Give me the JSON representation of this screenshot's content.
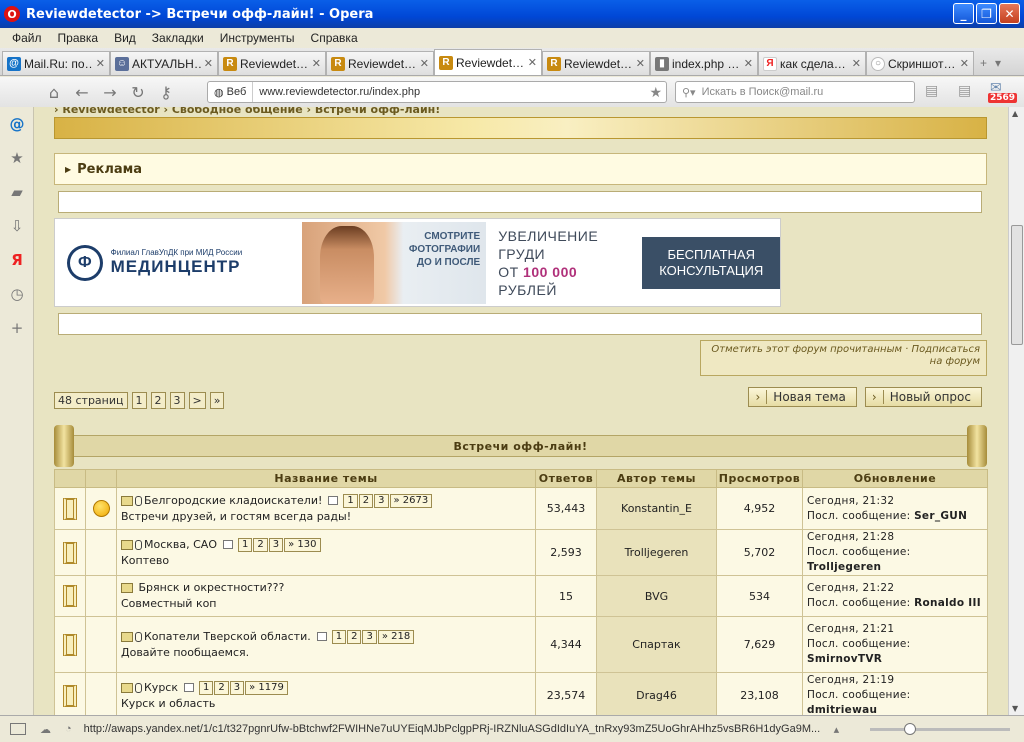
{
  "window": {
    "title": "Reviewdetector -> Встречи офф-лайн! - Opera"
  },
  "menu": [
    "Файл",
    "Правка",
    "Вид",
    "Закладки",
    "Инструменты",
    "Справка"
  ],
  "tabs": [
    {
      "label": "Mail.Ru: по…",
      "icon": "mailru-icon"
    },
    {
      "label": "АКТУАЛЬН…",
      "icon": "user-icon"
    },
    {
      "label": "Reviewdet…",
      "icon": "r-icon"
    },
    {
      "label": "Reviewdet…",
      "icon": "r-icon"
    },
    {
      "label": "Reviewdet…",
      "icon": "r-icon",
      "active": true
    },
    {
      "label": "Reviewdet…",
      "icon": "r-icon"
    },
    {
      "label": "index.php …",
      "icon": "page-icon"
    },
    {
      "label": "как сдела…",
      "icon": "yandex-icon"
    },
    {
      "label": "Скриншот…",
      "icon": "loading-icon"
    }
  ],
  "address": {
    "web_label": "Веб",
    "url": "www.reviewdetector.ru/index.php",
    "search_placeholder": "Искать в Поиск@mail.ru",
    "mail_count": "2569"
  },
  "page": {
    "breadcrumb": "› Reviewdetector › Свободное общение › Встречи офф-лайн!",
    "ad_title": "Реклама",
    "banner": {
      "org_small": "Филиал ГлавУпДК при МИД России",
      "org": "МЕДИНЦЕНТР",
      "photo_text": "СМОТРИТЕ ФОТОГРАФИИ ДО И ПОСЛЕ",
      "line1": "УВЕЛИЧЕНИЕ",
      "line2": "ГРУДИ",
      "line3a": "ОТ ",
      "price": "100 000",
      "line4": "РУБЛЕЙ",
      "cta": "БЕСПЛАТНАЯ КОНСУЛЬТАЦИЯ"
    },
    "mark_read": "Отметить этот форум прочитанным · Подписаться на форум",
    "pages_label": "48 страниц",
    "pages": [
      "1",
      "2",
      "3",
      ">",
      "»"
    ],
    "new_topic": "Новая тема",
    "new_poll": "Новый опрос",
    "forum_title": "Встречи офф-лайн!",
    "columns": [
      "Название темы",
      "Ответов",
      "Автор темы",
      "Просмотров",
      "Обновление"
    ],
    "topics": [
      {
        "title": "Белгородские кладоискатели!",
        "desc": "Встречи друзей, и гостям всегда рады!",
        "pages": [
          "1",
          "2",
          "3",
          "» 2673"
        ],
        "replies": "53,443",
        "author": "Konstantin_E",
        "views": "4,952",
        "time": "Сегодня, 21:32",
        "last_label": "Посл. сообщение:",
        "last": "Ser_GUN",
        "smile": true,
        "clip": true
      },
      {
        "title": "Москва, САО",
        "desc": "Коптево",
        "pages": [
          "1",
          "2",
          "3",
          "» 130"
        ],
        "replies": "2,593",
        "author": "Trolljegeren",
        "views": "5,702",
        "time": "Сегодня, 21:28",
        "last_label": "Посл. сообщение:",
        "last": "Trolljegeren",
        "clip": true
      },
      {
        "title": "Брянск и окрестности???",
        "desc": "Совместный коп",
        "pages": [],
        "replies": "15",
        "author": "BVG",
        "views": "534",
        "time": "Сегодня, 21:22",
        "last_label": "Посл. сообщение:",
        "last": "Ronaldo III"
      },
      {
        "title": "Копатели Тверской области.",
        "desc": "Довайте пообщаемся.",
        "pages": [
          "1",
          "2",
          "3",
          "» 218"
        ],
        "replies": "4,344",
        "author": "Спартак",
        "views": "7,629",
        "time": "Сегодня, 21:21",
        "last_label": "Посл. сообщение:",
        "last": "SmirnovTVR",
        "clip": true
      },
      {
        "title": "Курск",
        "desc": "Курск и область",
        "pages": [
          "1",
          "2",
          "3",
          "» 1179"
        ],
        "replies": "23,574",
        "author": "Drag46",
        "views": "23,108",
        "time": "Сегодня, 21:19",
        "last_label": "Посл. сообщение:",
        "last": "dmitriewau",
        "clip": true
      }
    ]
  },
  "status": {
    "url": "http://awaps.yandex.net/1/c1/t327pgnrUfw-bBtchwf2FWIHNe7uUYEiqMJbPclgpPRj-IRZNluASGdIdIuYA_tnRxy93mZ5UoGhrAHhz5vsBR6H1dyGa9M..."
  }
}
